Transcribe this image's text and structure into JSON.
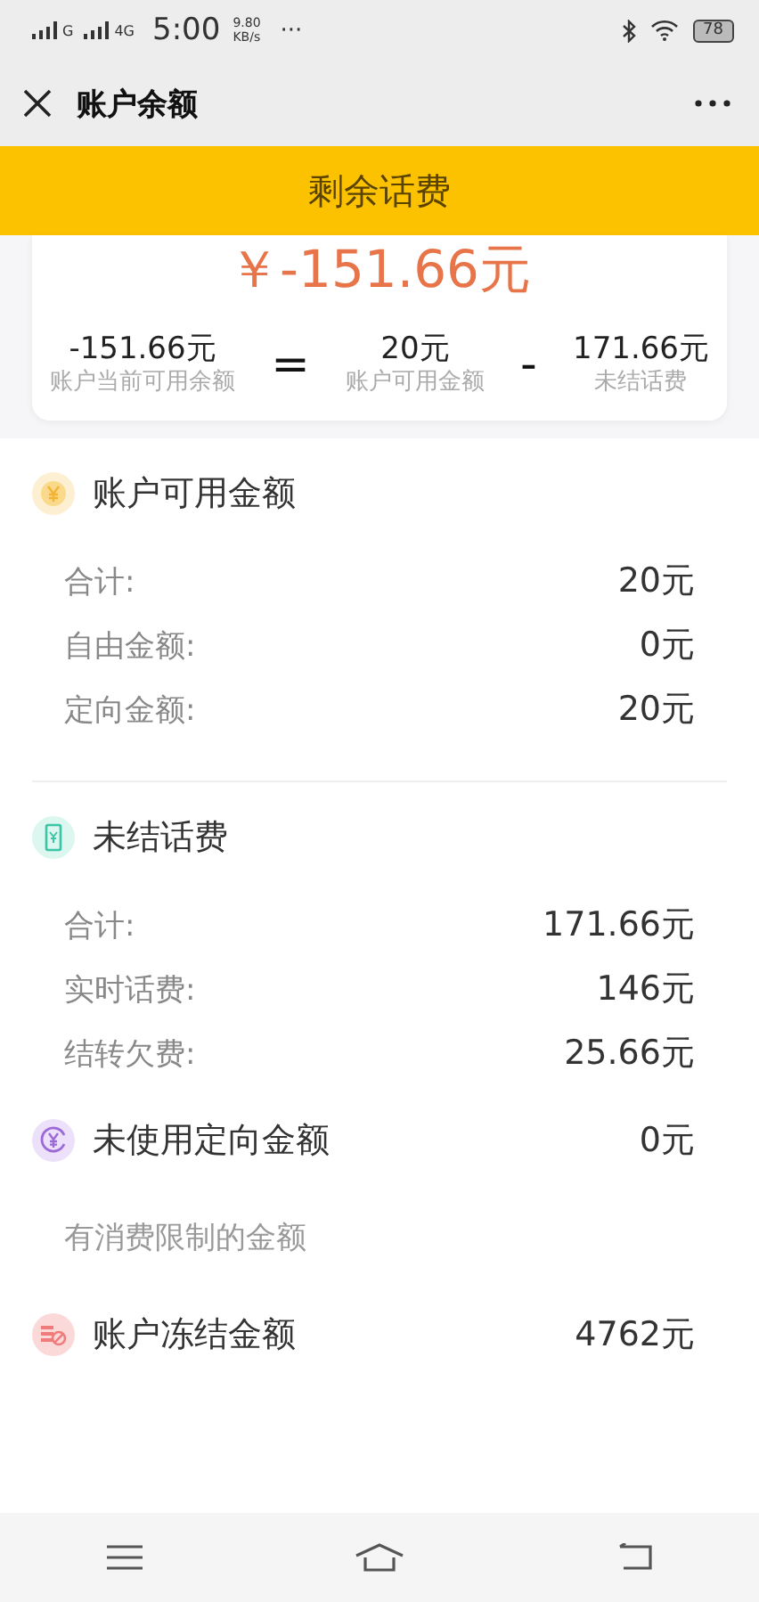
{
  "status_bar": {
    "network_1": "G",
    "network_2": "4G",
    "time": "5:00",
    "speed": "9.80",
    "speed_unit": "KB/s",
    "more": "···",
    "battery": "78"
  },
  "nav": {
    "title": "账户余额"
  },
  "banner": {
    "title": "剩余话费"
  },
  "summary": {
    "total": "￥-151.66元",
    "parts": [
      {
        "value": "-151.66元",
        "label": "账户当前可用余额"
      },
      {
        "operator": "="
      },
      {
        "value": "20元",
        "label": "账户可用金额"
      },
      {
        "operator": "-"
      },
      {
        "value": "171.66元",
        "label": "未结话费"
      }
    ]
  },
  "sections": [
    {
      "kind": "coin",
      "title": "账户可用金额",
      "rows": [
        {
          "label": "合计:",
          "value": "20元"
        },
        {
          "label": "自由金额:",
          "value": "0元"
        },
        {
          "label": "定向金额:",
          "value": "20元"
        }
      ]
    },
    {
      "kind": "phone",
      "title": "未结话费",
      "rows": [
        {
          "label": "合计:",
          "value": "171.66元"
        },
        {
          "label": "实时话费:",
          "value": "146元"
        },
        {
          "label": "结转欠费:",
          "value": "25.66元"
        }
      ]
    },
    {
      "kind": "refund",
      "title": "未使用定向金额",
      "value": "0元",
      "note": "有消费限制的金额"
    },
    {
      "kind": "frozen",
      "title": "账户冻结金额",
      "value": "4762元"
    }
  ]
}
